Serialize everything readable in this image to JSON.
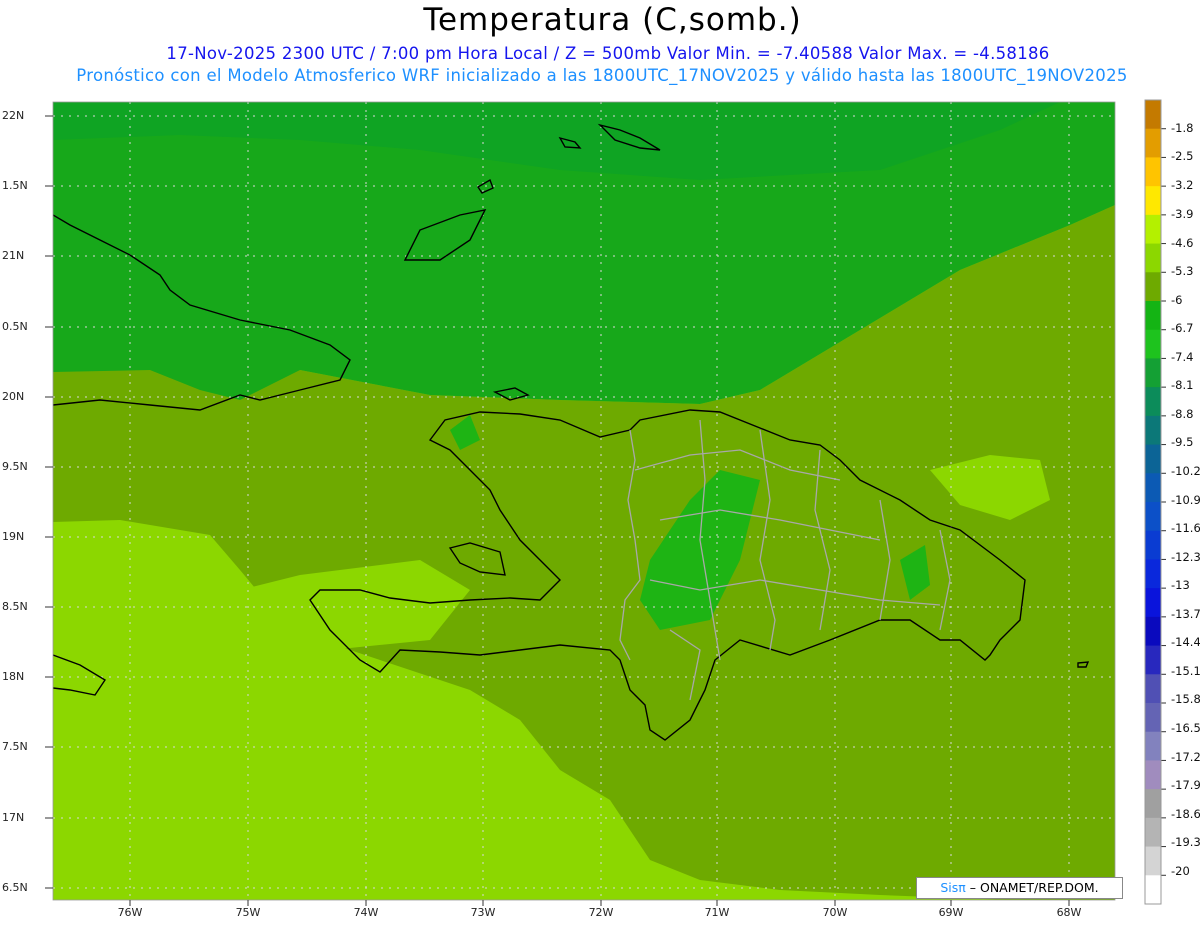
{
  "header": {
    "title": "Temperatura (C,somb.)",
    "subtitle_line1": "17-Nov-2025  2300 UTC / 7:00 pm Hora Local / Z = 500mb  Valor Min. = -7.40588  Valor Max. = -4.58186",
    "subtitle_line2": "Pronóstico con el Modelo Atmosferico WRF inicializado a las 1800UTC_17NOV2025 y válido hasta las  1800UTC_19NOV2025"
  },
  "axes": {
    "lat_labels": [
      "22N",
      "1.5N",
      "21N",
      "0.5N",
      "20N",
      "9.5N",
      "19N",
      "8.5N",
      "18N",
      "7.5N",
      "17N",
      "6.5N"
    ],
    "lon_labels": [
      "76W",
      "75W",
      "74W",
      "73W",
      "72W",
      "71W",
      "70W",
      "69W",
      "68W"
    ]
  },
  "colorbar": {
    "labels": [
      "-1.8",
      "-2.5",
      "-3.2",
      "-3.9",
      "-4.6",
      "-5.3",
      "-6",
      "-6.7",
      "-7.4",
      "-8.1",
      "-8.8",
      "-9.5",
      "-10.2",
      "-10.9",
      "-11.6",
      "-12.3",
      "-13",
      "-13.7",
      "-14.4",
      "-15.1",
      "-15.8",
      "-16.5",
      "-17.2",
      "-17.9",
      "-18.6",
      "-19.3",
      "-20"
    ],
    "colors": [
      "#c47a00",
      "#e39d00",
      "#ffc400",
      "#ffe800",
      "#b4f000",
      "#8cd700",
      "#6eaa00",
      "#14b414",
      "#1ec31e",
      "#14a034",
      "#0c8c5a",
      "#0c7878",
      "#0c6496",
      "#0c5ab4",
      "#0c50c8",
      "#0a3cd2",
      "#0a28dc",
      "#0a14dc",
      "#0a0abe",
      "#2828be",
      "#5050b4",
      "#6464b4",
      "#8282be",
      "#a08cbe",
      "#a0a0a0",
      "#b4b4b4",
      "#d4d4d4",
      "#ffffff"
    ]
  },
  "map_colors": {
    "north_band": "#17a81a",
    "north_inner": "#0fa423",
    "mid_band": "#6eaa00",
    "south_band": "#8cd700"
  },
  "credit": {
    "brand": "Sisπ",
    "text": " – ONAMET/REP.DOM."
  }
}
